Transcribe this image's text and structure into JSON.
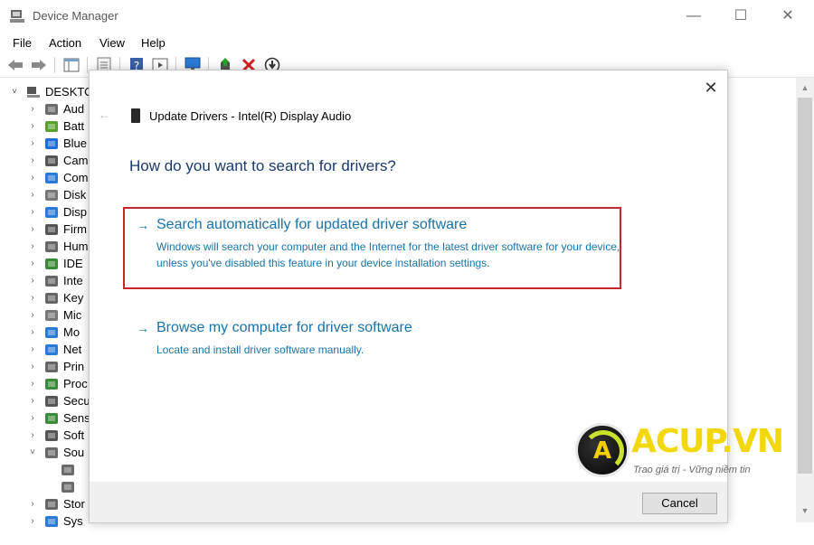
{
  "window": {
    "title": "Device Manager",
    "minimize": "—",
    "maximize": "☐",
    "close": "✕"
  },
  "menu": {
    "items": [
      "File",
      "Action",
      "View",
      "Help"
    ]
  },
  "tree": {
    "root": "DESKTO",
    "items": [
      {
        "label": "Aud",
        "icon": "speaker-icon",
        "color": "#6a6a6a"
      },
      {
        "label": "Batt",
        "icon": "battery-icon",
        "color": "#5aa02c"
      },
      {
        "label": "Blue",
        "icon": "bluetooth-icon",
        "color": "#1e6fd9"
      },
      {
        "label": "Cam",
        "icon": "camera-icon",
        "color": "#555555"
      },
      {
        "label": "Com",
        "icon": "monitor-icon",
        "color": "#2b7bd6"
      },
      {
        "label": "Disk",
        "icon": "disk-icon",
        "color": "#777777"
      },
      {
        "label": "Disp",
        "icon": "display-icon",
        "color": "#2b7bd6"
      },
      {
        "label": "Firm",
        "icon": "firmware-icon",
        "color": "#555555"
      },
      {
        "label": "Hum",
        "icon": "hid-icon",
        "color": "#666666"
      },
      {
        "label": "IDE",
        "icon": "ide-icon",
        "color": "#3a8a3a"
      },
      {
        "label": "Inte",
        "icon": "interface-icon",
        "color": "#666666"
      },
      {
        "label": "Key",
        "icon": "keyboard-icon",
        "color": "#666666"
      },
      {
        "label": "Mic",
        "icon": "mouse-icon",
        "color": "#777777"
      },
      {
        "label": "Mo",
        "icon": "monitor-icon",
        "color": "#2b7bd6"
      },
      {
        "label": "Net",
        "icon": "network-icon",
        "color": "#2b7bd6"
      },
      {
        "label": "Prin",
        "icon": "printer-icon",
        "color": "#666666"
      },
      {
        "label": "Proc",
        "icon": "processor-icon",
        "color": "#3a8a3a"
      },
      {
        "label": "Secu",
        "icon": "security-icon",
        "color": "#555555"
      },
      {
        "label": "Sens",
        "icon": "sensor-icon",
        "color": "#3a8a3a"
      },
      {
        "label": "Soft",
        "icon": "software-icon",
        "color": "#555555"
      },
      {
        "label": "Sou",
        "icon": "speaker-icon",
        "color": "#6a6a6a",
        "expanded": true
      },
      {
        "label": "",
        "icon": "speaker-icon",
        "color": "#6a6a6a",
        "child": true
      },
      {
        "label": "",
        "icon": "speaker-icon",
        "color": "#6a6a6a",
        "child": true
      },
      {
        "label": "Stor",
        "icon": "storage-icon",
        "color": "#666666"
      },
      {
        "label": "Sys",
        "icon": "system-icon",
        "color": "#2b7bd6"
      }
    ]
  },
  "dialog": {
    "close": "✕",
    "back": "←",
    "title": "Update Drivers - Intel(R) Display Audio",
    "heading": "How do you want to search for drivers?",
    "option1": {
      "arrow": "→",
      "title": "Search automatically for updated driver software",
      "desc": "Windows will search your computer and the Internet for the latest driver software for your device, unless you've disabled this feature in your device installation settings."
    },
    "option2": {
      "arrow": "→",
      "title": "Browse my computer for driver software",
      "desc": "Locate and install driver software manually."
    },
    "cancel": "Cancel"
  },
  "watermark": {
    "letter": "A",
    "brand": "ACUP.VN",
    "slogan": "Trao giá trị - Vững niềm tin"
  },
  "colors": {
    "link": "#1a73a8",
    "heading": "#1b3a6b",
    "highlight": "#c8262e",
    "brand": "#f2d80a"
  }
}
